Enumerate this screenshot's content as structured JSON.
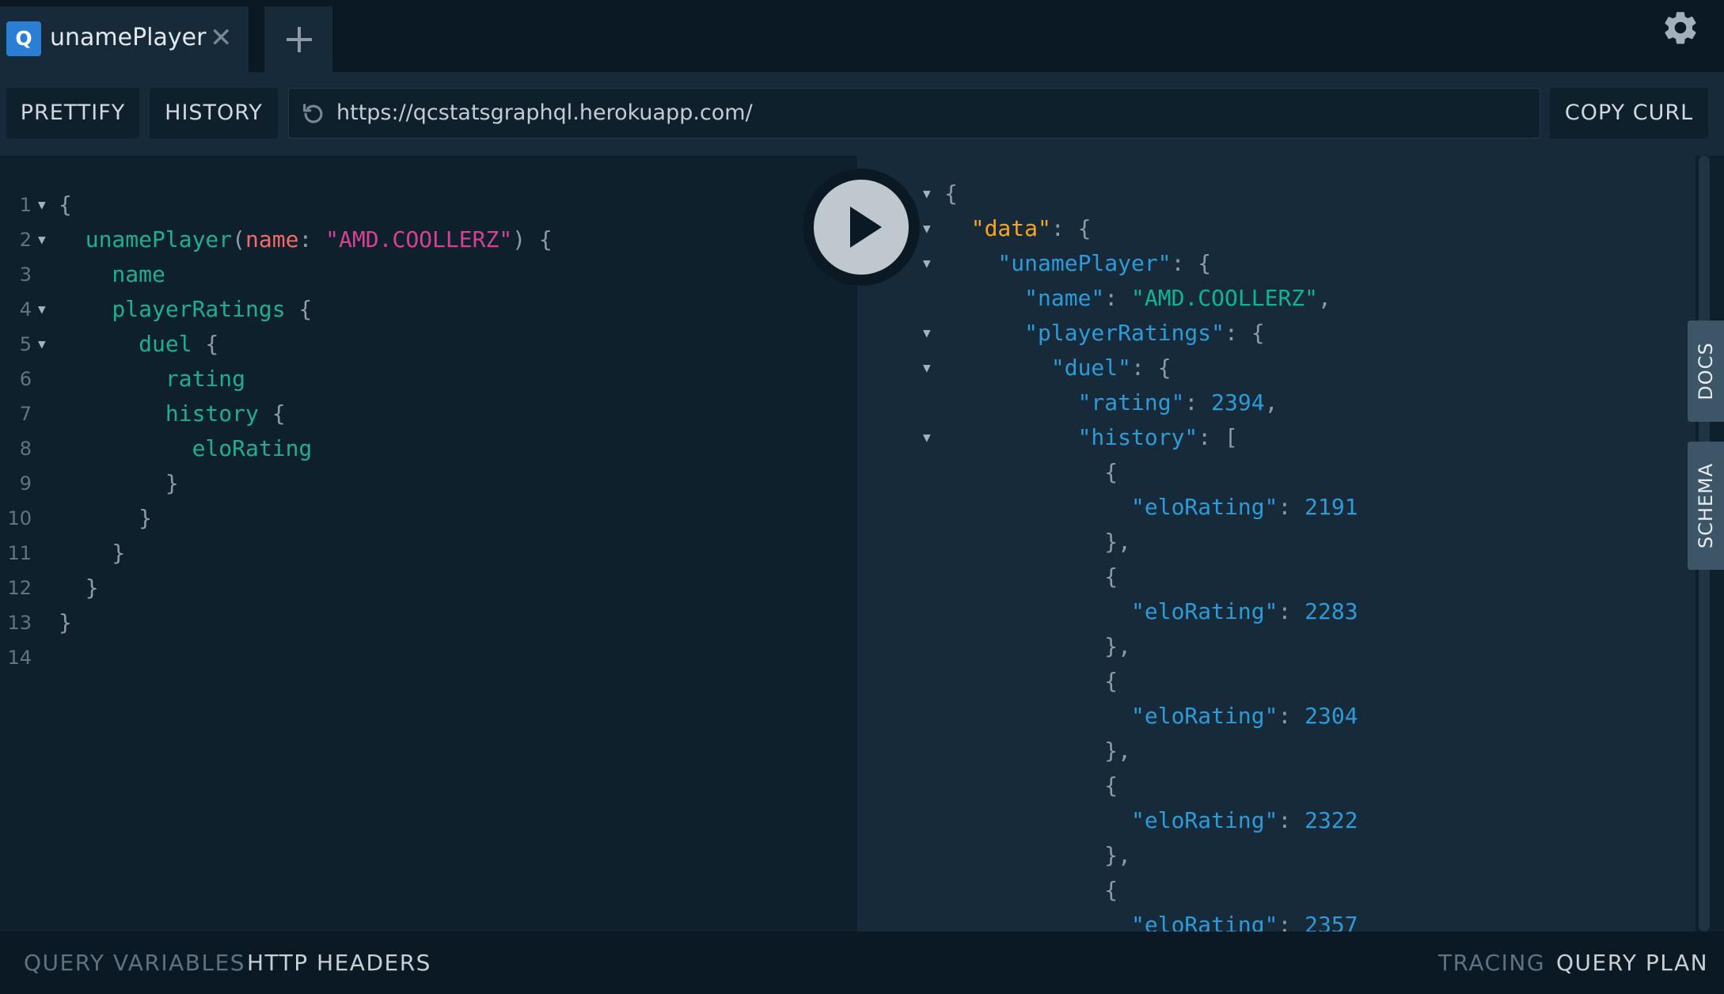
{
  "tab": {
    "icon_letter": "Q",
    "title": "unamePlayer",
    "close": "✕",
    "add_icon": "plus-icon"
  },
  "toolbar": {
    "prettify": "PRETTIFY",
    "history": "HISTORY",
    "copy_curl": "COPY CURL"
  },
  "url": {
    "value": "https://qcstatsgraphql.herokuapp.com/",
    "icon": "reload-icon"
  },
  "query_lines": [
    {
      "n": "1",
      "fold": true,
      "t": [
        {
          "c": "punc",
          "v": "{"
        }
      ]
    },
    {
      "n": "2",
      "fold": true,
      "t": [
        {
          "c": "field",
          "v": "  unamePlayer"
        },
        {
          "c": "punc",
          "v": "("
        },
        {
          "c": "arg",
          "v": "name"
        },
        {
          "c": "punc",
          "v": ": "
        },
        {
          "c": "str",
          "v": "\"AMD.COOLLERZ\""
        },
        {
          "c": "punc",
          "v": ") {"
        }
      ]
    },
    {
      "n": "3",
      "fold": false,
      "t": [
        {
          "c": "field",
          "v": "    name"
        }
      ]
    },
    {
      "n": "4",
      "fold": true,
      "t": [
        {
          "c": "field",
          "v": "    playerRatings"
        },
        {
          "c": "punc",
          "v": " {"
        }
      ]
    },
    {
      "n": "5",
      "fold": true,
      "t": [
        {
          "c": "field",
          "v": "      duel"
        },
        {
          "c": "punc",
          "v": " {"
        }
      ]
    },
    {
      "n": "6",
      "fold": false,
      "t": [
        {
          "c": "field",
          "v": "        rating"
        }
      ]
    },
    {
      "n": "7",
      "fold": false,
      "t": [
        {
          "c": "field",
          "v": "        history"
        },
        {
          "c": "punc",
          "v": " {"
        }
      ]
    },
    {
      "n": "8",
      "fold": false,
      "t": [
        {
          "c": "field",
          "v": "          eloRating"
        }
      ]
    },
    {
      "n": "9",
      "fold": false,
      "t": [
        {
          "c": "punc",
          "v": "        }"
        }
      ]
    },
    {
      "n": "10",
      "fold": false,
      "t": [
        {
          "c": "punc",
          "v": "      }"
        }
      ]
    },
    {
      "n": "11",
      "fold": false,
      "t": [
        {
          "c": "punc",
          "v": "    }"
        }
      ]
    },
    {
      "n": "12",
      "fold": false,
      "t": [
        {
          "c": "punc",
          "v": "  }"
        }
      ]
    },
    {
      "n": "13",
      "fold": false,
      "t": [
        {
          "c": "punc",
          "v": "}"
        }
      ]
    },
    {
      "n": "14",
      "fold": false,
      "t": []
    }
  ],
  "result_lines": [
    {
      "fold": true,
      "t": [
        {
          "c": "punc",
          "v": "{"
        }
      ]
    },
    {
      "fold": true,
      "t": [
        {
          "c": "keyorange",
          "v": "  \"data\""
        },
        {
          "c": "punc",
          "v": ": {"
        }
      ]
    },
    {
      "fold": true,
      "t": [
        {
          "c": "key",
          "v": "    \"unamePlayer\""
        },
        {
          "c": "punc",
          "v": ": {"
        }
      ]
    },
    {
      "fold": false,
      "t": [
        {
          "c": "key",
          "v": "      \"name\""
        },
        {
          "c": "punc",
          "v": ": "
        },
        {
          "c": "jstr",
          "v": "\"AMD.COOLLERZ\""
        },
        {
          "c": "punc",
          "v": ","
        }
      ]
    },
    {
      "fold": true,
      "t": [
        {
          "c": "key",
          "v": "      \"playerRatings\""
        },
        {
          "c": "punc",
          "v": ": {"
        }
      ]
    },
    {
      "fold": true,
      "t": [
        {
          "c": "key",
          "v": "        \"duel\""
        },
        {
          "c": "punc",
          "v": ": {"
        }
      ]
    },
    {
      "fold": false,
      "t": [
        {
          "c": "key",
          "v": "          \"rating\""
        },
        {
          "c": "punc",
          "v": ": "
        },
        {
          "c": "num",
          "v": "2394"
        },
        {
          "c": "punc",
          "v": ","
        }
      ]
    },
    {
      "fold": true,
      "t": [
        {
          "c": "key",
          "v": "          \"history\""
        },
        {
          "c": "punc",
          "v": ": ["
        }
      ]
    },
    {
      "fold": false,
      "t": [
        {
          "c": "punc",
          "v": "            {"
        }
      ]
    },
    {
      "fold": false,
      "t": [
        {
          "c": "key",
          "v": "              \"eloRating\""
        },
        {
          "c": "punc",
          "v": ": "
        },
        {
          "c": "num",
          "v": "2191"
        }
      ]
    },
    {
      "fold": false,
      "t": [
        {
          "c": "punc",
          "v": "            },"
        }
      ]
    },
    {
      "fold": false,
      "t": [
        {
          "c": "punc",
          "v": "            {"
        }
      ]
    },
    {
      "fold": false,
      "t": [
        {
          "c": "key",
          "v": "              \"eloRating\""
        },
        {
          "c": "punc",
          "v": ": "
        },
        {
          "c": "num",
          "v": "2283"
        }
      ]
    },
    {
      "fold": false,
      "t": [
        {
          "c": "punc",
          "v": "            },"
        }
      ]
    },
    {
      "fold": false,
      "t": [
        {
          "c": "punc",
          "v": "            {"
        }
      ]
    },
    {
      "fold": false,
      "t": [
        {
          "c": "key",
          "v": "              \"eloRating\""
        },
        {
          "c": "punc",
          "v": ": "
        },
        {
          "c": "num",
          "v": "2304"
        }
      ]
    },
    {
      "fold": false,
      "t": [
        {
          "c": "punc",
          "v": "            },"
        }
      ]
    },
    {
      "fold": false,
      "t": [
        {
          "c": "punc",
          "v": "            {"
        }
      ]
    },
    {
      "fold": false,
      "t": [
        {
          "c": "key",
          "v": "              \"eloRating\""
        },
        {
          "c": "punc",
          "v": ": "
        },
        {
          "c": "num",
          "v": "2322"
        }
      ]
    },
    {
      "fold": false,
      "t": [
        {
          "c": "punc",
          "v": "            },"
        }
      ]
    },
    {
      "fold": false,
      "t": [
        {
          "c": "punc",
          "v": "            {"
        }
      ]
    },
    {
      "fold": false,
      "t": [
        {
          "c": "key",
          "v": "              \"eloRating\""
        },
        {
          "c": "punc",
          "v": ": "
        },
        {
          "c": "num",
          "v": "2357"
        }
      ]
    }
  ],
  "side": {
    "docs": "DOCS",
    "schema": "SCHEMA"
  },
  "bottom": {
    "query_variables": "QUERY VARIABLES",
    "http_headers": "HTTP HEADERS",
    "tracing": "TRACING",
    "query_plan": "QUERY PLAN"
  },
  "colors": {
    "background": "#0f202d",
    "result_bg": "#172a3a",
    "field": "#1fae92",
    "string": "#d64292",
    "key": "#2d9bd8",
    "accent": "#2a7ed3"
  }
}
